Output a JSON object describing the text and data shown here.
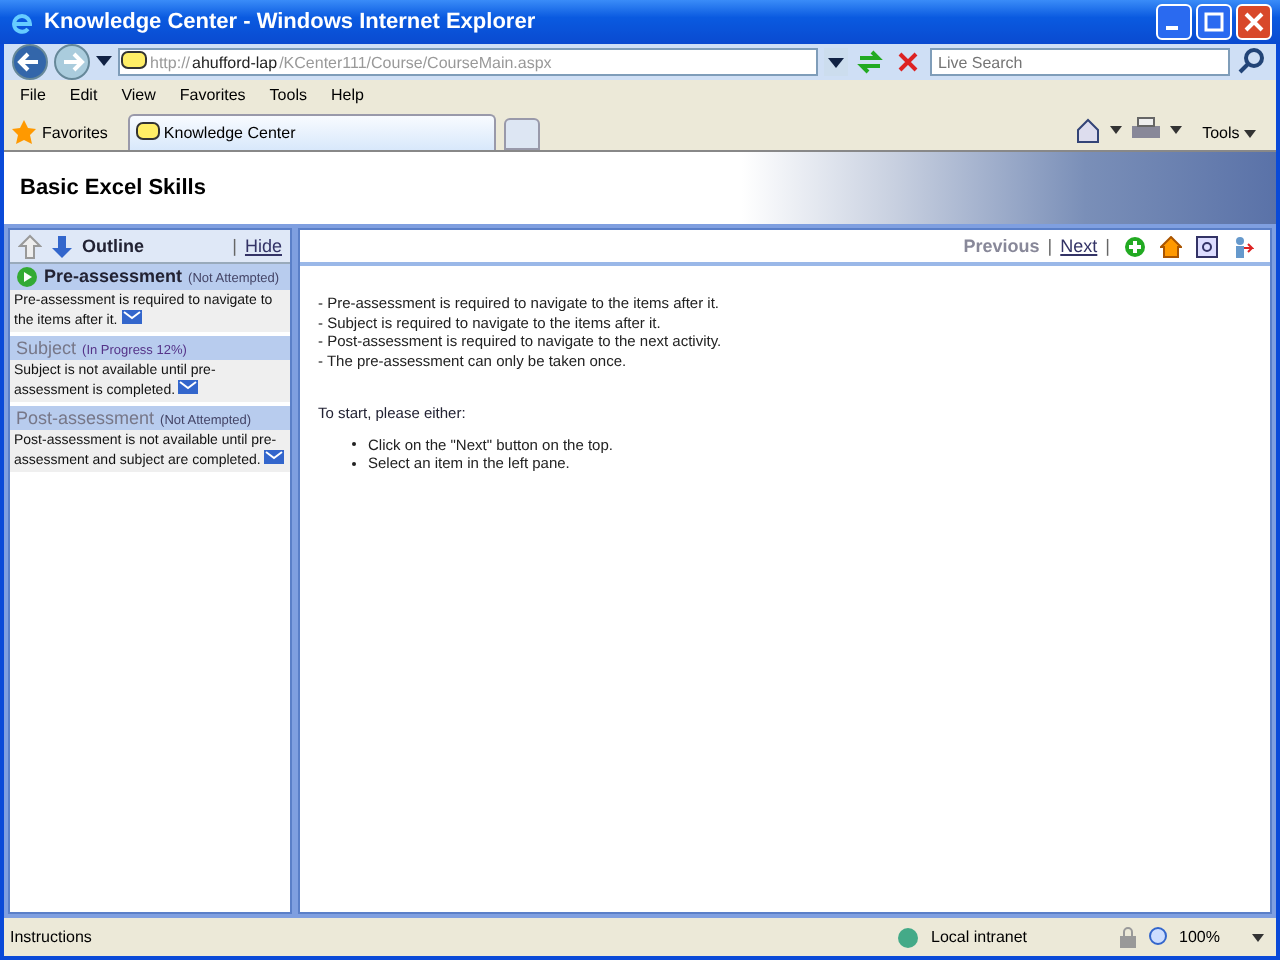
{
  "window": {
    "title": "Knowledge Center - Windows Internet Explorer"
  },
  "address": {
    "scheme": "http://",
    "host": "ahufford-lap",
    "path": "/KCenter111/Course/CourseMain.aspx"
  },
  "search": {
    "placeholder": "Live Search"
  },
  "menu": [
    "File",
    "Edit",
    "View",
    "Favorites",
    "Tools",
    "Help"
  ],
  "favorites_label": "Favorites",
  "tabs": [
    {
      "label": "Knowledge Center",
      "selected": true
    }
  ],
  "toolbar_tools": "Tools",
  "page": {
    "title": "Basic Excel Skills",
    "outline": {
      "title": "Outline",
      "separator": "|",
      "hide": "Hide",
      "items": [
        {
          "title": "Pre-assessment",
          "status": "(Not Attempted)",
          "note": "Pre-assessment is required to navigate to the items after it.",
          "selected": true
        },
        {
          "title": "Subject",
          "status": "(In Progress 12%)",
          "note": "Subject is not available until pre-assessment is completed.",
          "selected": false
        },
        {
          "title": "Post-assessment",
          "status": "(Not Attempted)",
          "note": "Post-assessment is not available until pre-assessment and subject are completed.",
          "selected": false
        }
      ]
    },
    "nav": {
      "previous": "Previous",
      "separator_1": "|",
      "next": "Next",
      "separator_2": "|"
    },
    "rules": [
      "- Pre-assessment is required to navigate to the items after it.",
      "- Subject is required to navigate to the items after it.",
      "- Post-assessment is required to navigate to the next activity.",
      "- The pre-assessment can only be taken once."
    ],
    "start": "To start, please either:",
    "steps": [
      "Click on the \"Next\" button on the top.",
      "Select an item in the left pane."
    ]
  },
  "status_bar": {
    "text": "Instructions",
    "zone": "Local intranet",
    "zoom": "100%"
  }
}
